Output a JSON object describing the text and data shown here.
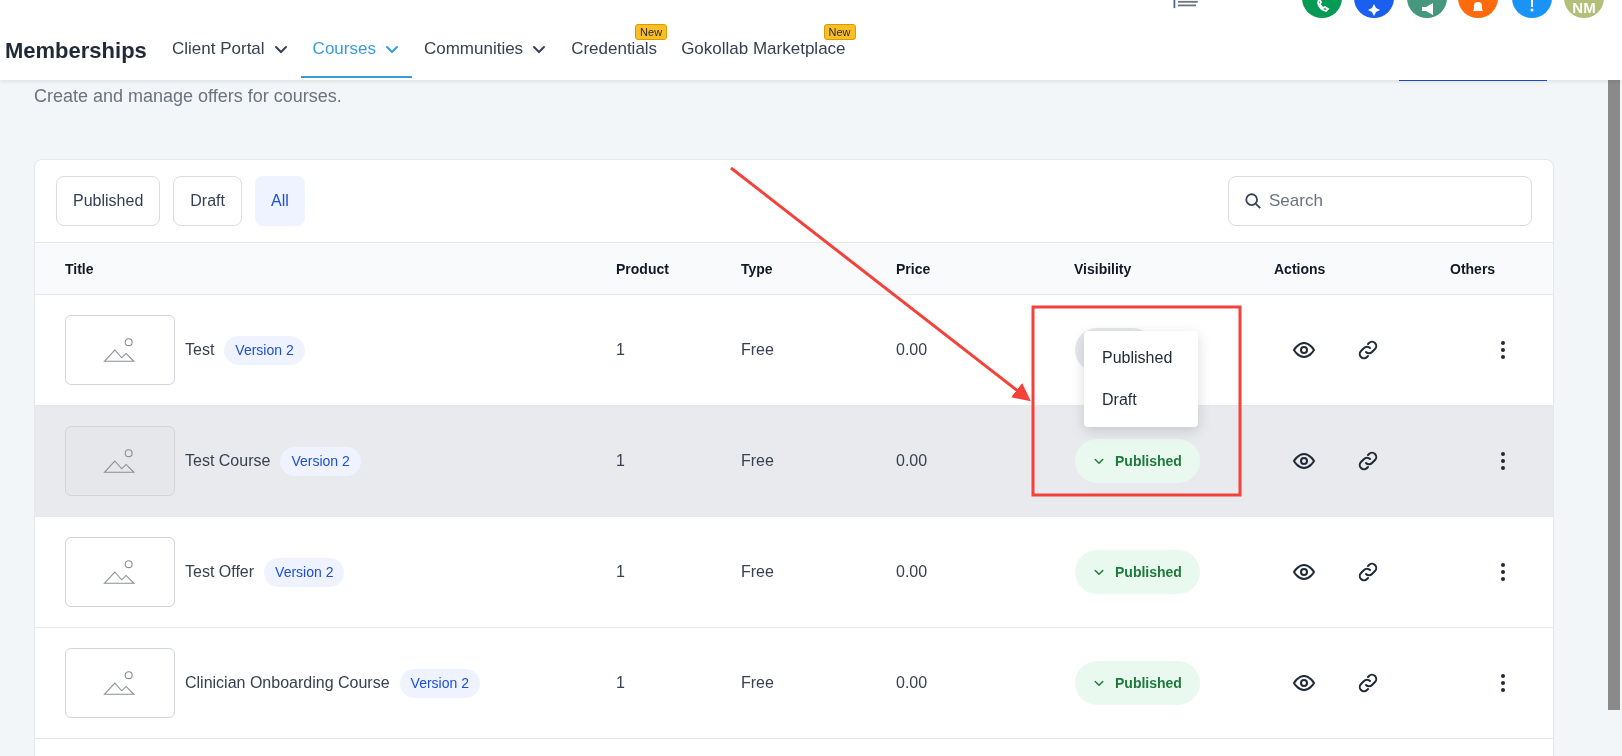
{
  "header": {
    "title": "Memberships",
    "tabs": [
      {
        "label": "Client Portal",
        "selected": false,
        "dropdown": true
      },
      {
        "label": "Courses",
        "selected": true,
        "dropdown": true
      },
      {
        "label": "Communities",
        "selected": false,
        "dropdown": true
      },
      {
        "label": "Credentials",
        "selected": false,
        "dropdown": false,
        "badge": "New"
      },
      {
        "label": "Gokollab Marketplace",
        "selected": false,
        "dropdown": false,
        "badge": "New"
      }
    ],
    "top_buttons": [
      {
        "kind": "phone",
        "color": "#059b55"
      },
      {
        "kind": "sparkle",
        "color": "#1a5ff0"
      },
      {
        "kind": "megaphone",
        "color": "#45977d"
      },
      {
        "kind": "bell",
        "color": "#ff6a0c"
      },
      {
        "kind": "help",
        "color": "#1a93f7"
      },
      {
        "kind": "avatar",
        "color": "#b3bf78",
        "initials": "NM"
      }
    ]
  },
  "subtitle": "Create and manage offers for courses.",
  "filters": [
    {
      "label": "Published",
      "selected": false
    },
    {
      "label": "Draft",
      "selected": false
    },
    {
      "label": "All",
      "selected": true
    }
  ],
  "search": {
    "placeholder": "Search"
  },
  "table": {
    "columns": [
      "Title",
      "Product",
      "Type",
      "Price",
      "Visibility",
      "Actions",
      "Others"
    ],
    "rows": [
      {
        "title": "Test",
        "version": "Version 2",
        "product": "1",
        "type": "Free",
        "price": "0.00",
        "highlighted": false,
        "menu_open": true
      },
      {
        "title": "Test Course",
        "version": "Version 2",
        "product": "1",
        "type": "Free",
        "price": "0.00",
        "highlighted": true,
        "menu_open": false,
        "visibility": "Published"
      },
      {
        "title": "Test Offer",
        "version": "Version 2",
        "product": "1",
        "type": "Free",
        "price": "0.00",
        "highlighted": false,
        "menu_open": false,
        "visibility": "Published"
      },
      {
        "title": "Clinician Onboarding Course",
        "version": "Version 2",
        "product": "1",
        "type": "Free",
        "price": "0.00",
        "highlighted": false,
        "menu_open": false,
        "visibility": "Published"
      }
    ]
  },
  "visibility_menu": [
    "Published",
    "Draft"
  ]
}
